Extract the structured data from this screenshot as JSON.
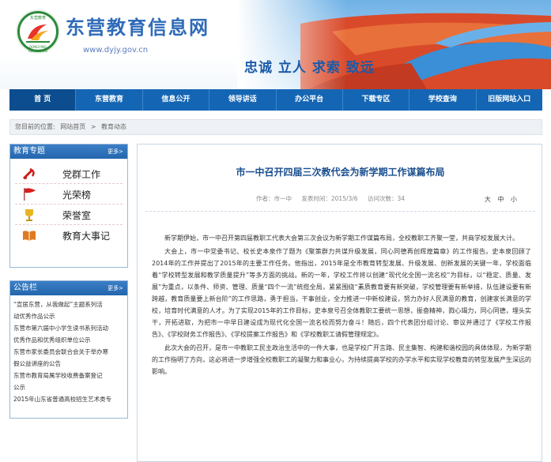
{
  "site": {
    "title": "东营教育信息网",
    "url": "www.dyjy.gov.cn",
    "slogan": "忠诚 立人 求索 致远",
    "logo_top": "东营教育",
    "logo_bottom": "DONGYING EDUCATION"
  },
  "nav": {
    "items": [
      {
        "label": "首  页"
      },
      {
        "label": "东营教育"
      },
      {
        "label": "信息公开"
      },
      {
        "label": "领导讲话"
      },
      {
        "label": "办公平台"
      },
      {
        "label": "下载专区"
      },
      {
        "label": "学校查询"
      },
      {
        "label": "旧版网站入口"
      }
    ]
  },
  "breadcrumb": {
    "prefix": "您目前的位置:",
    "home": "网站首页",
    "sep": ">",
    "current": "教育动态"
  },
  "special": {
    "title": "教育专题",
    "more": "更多>",
    "items": [
      {
        "label": "党群工作",
        "icon": "party-emblem-icon"
      },
      {
        "label": "光荣榜",
        "icon": "flag-icon"
      },
      {
        "label": "荣誉室",
        "icon": "trophy-icon"
      },
      {
        "label": "教育大事记",
        "icon": "book-icon"
      }
    ]
  },
  "notice": {
    "title": "公告栏",
    "more": "更多>",
    "items": [
      "“宣居东营，从我做起”主题系列活",
      "动优秀作品公示",
      "东营市第六届中小学生读书系列活动",
      "优秀作品和优秀组织单位公示",
      "东营市家长委员会联合会关于举办寒",
      "假公益讲座的公告",
      "东营市教育局属学校收费备案登记",
      "公示",
      "2015年山东省普通高校招生艺术类专"
    ]
  },
  "article": {
    "title": "市一中召开四届三次教代会为新学期工作谋篇布局",
    "author": "作者：市一中",
    "date": "发表时间：2015/3/6",
    "visits": "访问次数：34",
    "font_size": "大 中 小",
    "paragraphs": [
      "新学期伊始，市一中召开第四届教职工代表大会第三次会议为新学期工作谋篇布局，全校教职工齐聚一堂，共商学校发展大计。",
      "大会上，市一中党委书记、校长史本泉作了题为《聚策群力共谋升级发展，同心同德再创辉煌篇章》的工作报告。史本泉回顾了2014年的工作并提出了2015年的主要工作任务。他指出，2015年是全市教育转型发展、升级发展、创新发展的关键一年，学校面临着“学校转型发展和教学质量提升”等多方面的挑战。新的一年，学校工作将以创建“现代化全国一流名校”为目标，以“稳定、质量、发展”为重点，以条件、师资、管理、质量“四个一流”统揽全局，紧紧围绕“素质教育要有新突破，学校管理要有新举措，队伍建设要有新跨越，教育质量要上新台阶”的工作思路，勇于担当，干事创业，全力推进一中新校建设，努力办好人民满意的教育，创建家长满意的学校，培育时代满意的人才。为了实现2015年的工作目标，史本泉号召全体教职工要统一思想，振奋精神，戮心竭力，同心同德，埋头实干，开拓进取，为把市一中早日建设成为现代化全国一流名校而努力奋斗！随后，四个代表团分组讨论、审议并通过了《学校工作报告》、《学校财务工作报告》、《学校提案工作报告》和《学校教职工请假管理规定》。",
      "此次大会的召开，是市一中教职工民主政治生活中的一件大事，也是学校广开言路、民主集智、构建和谐校园的具体体现，为新学期的工作指明了方向，这必将进一步增强全校教职工的凝聚力和事业心，为持续提高学校的办学水平和实现学校教育的转型发展产生深远的影响。"
    ]
  },
  "colors": {
    "nav": "#1466b4",
    "title_blue": "#2f6bb8",
    "article_title": "#1a4f8f"
  }
}
